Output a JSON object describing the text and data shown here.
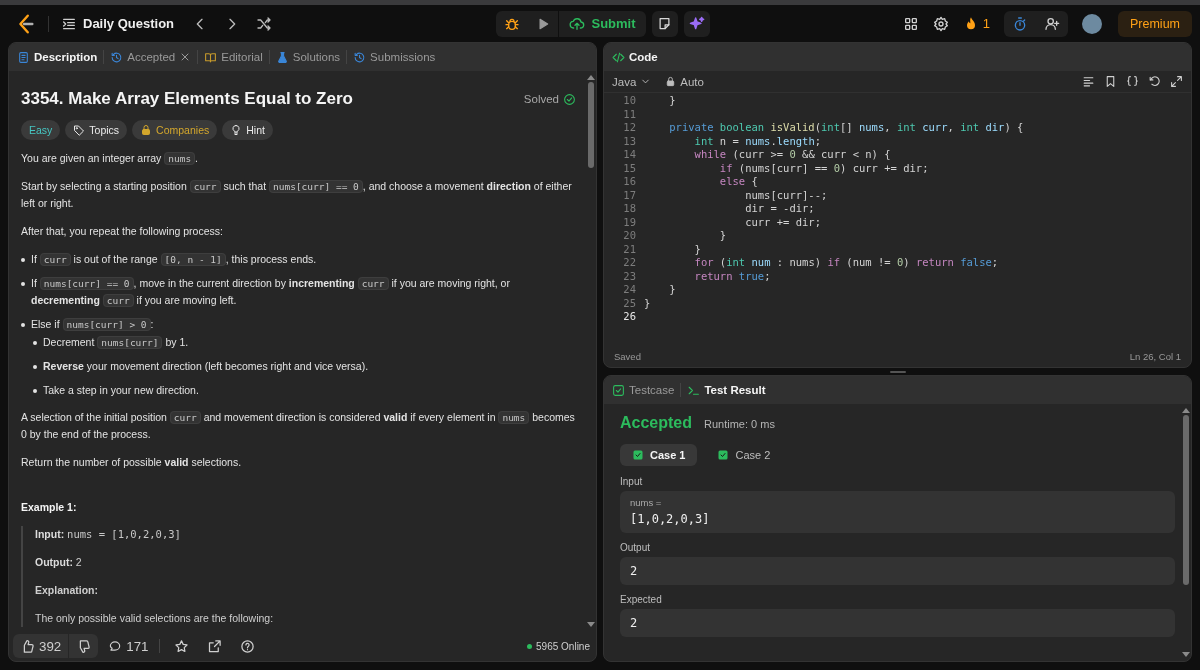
{
  "top_bar": {
    "title": "Daily Question",
    "submit": "Submit",
    "streak": "1",
    "premium": "Premium"
  },
  "description_panel": {
    "tabs": [
      {
        "label": "Description",
        "kind": "description",
        "selected": true,
        "closable": false
      },
      {
        "label": "Accepted",
        "kind": "accepted",
        "selected": false,
        "closable": true
      },
      {
        "label": "Editorial",
        "kind": "editorial",
        "selected": false,
        "closable": false
      },
      {
        "label": "Solutions",
        "kind": "solutions",
        "selected": false,
        "closable": false
      },
      {
        "label": "Submissions",
        "kind": "submissions",
        "selected": false,
        "closable": false
      }
    ],
    "title": "3354. Make Array Elements Equal to Zero",
    "status": "Solved",
    "tags": [
      {
        "label": "Easy",
        "kind": "difficulty"
      },
      {
        "label": "Topics",
        "kind": "topics"
      },
      {
        "label": "Companies",
        "kind": "companies"
      },
      {
        "label": "Hint",
        "kind": "hint"
      }
    ],
    "body": [
      {
        "kind": "paragraph",
        "segments": [
          {
            "kind": "text",
            "text": "You are given an integer array "
          },
          {
            "kind": "code",
            "text": "nums"
          },
          {
            "kind": "text",
            "text": "."
          }
        ]
      },
      {
        "kind": "paragraph",
        "segments": [
          {
            "kind": "text",
            "text": "Start by selecting a starting position "
          },
          {
            "kind": "code",
            "text": "curr"
          },
          {
            "kind": "text",
            "text": " such that "
          },
          {
            "kind": "code",
            "text": "nums[curr] == 0"
          },
          {
            "kind": "text",
            "text": ", and choose a movement **direction** of either left or right."
          }
        ]
      },
      {
        "kind": "paragraph",
        "segments": [
          {
            "kind": "text",
            "text": "After that, you repeat the following process:"
          }
        ]
      },
      {
        "kind": "list",
        "items": [
          {
            "segments": [
              {
                "kind": "text",
                "text": "If "
              },
              {
                "kind": "code",
                "text": "curr"
              },
              {
                "kind": "text",
                "text": " is out of the range "
              },
              {
                "kind": "code",
                "text": "[0, n - 1]"
              },
              {
                "kind": "text",
                "text": ", this process ends."
              }
            ]
          },
          {
            "segments": [
              {
                "kind": "text",
                "text": "If "
              },
              {
                "kind": "code",
                "text": "nums[curr] == 0"
              },
              {
                "kind": "text",
                "text": ", move in the current direction by **incrementing** "
              },
              {
                "kind": "code",
                "text": "curr"
              },
              {
                "kind": "text",
                "text": " if you are moving right, or **decrementing** "
              },
              {
                "kind": "code",
                "text": "curr"
              },
              {
                "kind": "text",
                "text": " if you are moving left."
              }
            ]
          },
          {
            "segments": [
              {
                "kind": "text",
                "text": "Else if "
              },
              {
                "kind": "code",
                "text": "nums[curr] > 0"
              },
              {
                "kind": "text",
                "text": ":"
              }
            ],
            "children": [
              {
                "segments": [
                  {
                    "kind": "text",
                    "text": "Decrement "
                  },
                  {
                    "kind": "code",
                    "text": "nums[curr]"
                  },
                  {
                    "kind": "text",
                    "text": " by 1."
                  }
                ]
              },
              {
                "segments": [
                  {
                    "kind": "text",
                    "text": "**Reverse** your movement direction (left becomes right and vice versa)."
                  }
                ]
              },
              {
                "segments": [
                  {
                    "kind": "text",
                    "text": "Take a step in your new direction."
                  }
                ]
              }
            ]
          }
        ]
      },
      {
        "kind": "paragraph",
        "segments": [
          {
            "kind": "text",
            "text": "A selection of the initial position "
          },
          {
            "kind": "code",
            "text": "curr"
          },
          {
            "kind": "text",
            "text": " and movement direction is considered **valid** if every element in "
          },
          {
            "kind": "code",
            "text": "nums"
          },
          {
            "kind": "text",
            "text": " becomes 0 by the end of the process."
          }
        ]
      },
      {
        "kind": "paragraph",
        "segments": [
          {
            "kind": "text",
            "text": "Return the number of possible **valid** selections."
          }
        ]
      },
      {
        "kind": "heading",
        "text": "Example 1:"
      },
      {
        "kind": "example",
        "lines": [
          {
            "segments": [
              {
                "kind": "text",
                "text": "**Input:** "
              },
              {
                "kind": "mono",
                "text": "nums = [1,0,2,0,3]"
              }
            ]
          },
          {
            "segments": [
              {
                "kind": "text",
                "text": "**Output:** 2"
              }
            ]
          },
          {
            "segments": [
              {
                "kind": "label",
                "text": "Explanation:"
              }
            ]
          },
          {
            "segments": [
              {
                "kind": "text",
                "text": "The only possible valid selections are the following:"
              }
            ]
          }
        ]
      }
    ],
    "footer": {
      "likes": "392",
      "comments": "171",
      "online": "5965 Online"
    }
  },
  "code_panel": {
    "title": "Code",
    "language": "Java",
    "mode": "Auto",
    "lines": [
      {
        "number": "10",
        "current": false,
        "tokens": [
          {
            "kind": "plain",
            "text": "    }"
          }
        ]
      },
      {
        "number": "11",
        "current": false
      },
      {
        "number": "12",
        "current": false,
        "tokens": [
          {
            "kind": "modifier",
            "text": "    private "
          },
          {
            "kind": "type",
            "text": "boolean "
          },
          {
            "kind": "function",
            "text": "isValid"
          },
          {
            "kind": "plain",
            "text": "("
          },
          {
            "kind": "type",
            "text": "int"
          },
          {
            "kind": "plain",
            "text": "[] "
          },
          {
            "kind": "variable",
            "text": "nums"
          },
          {
            "kind": "plain",
            "text": ", "
          },
          {
            "kind": "type",
            "text": "int "
          },
          {
            "kind": "variable",
            "text": "curr"
          },
          {
            "kind": "plain",
            "text": ", "
          },
          {
            "kind": "type",
            "text": "int "
          },
          {
            "kind": "variable",
            "text": "dir"
          },
          {
            "kind": "plain",
            "text": ") {"
          }
        ]
      },
      {
        "number": "13",
        "current": false,
        "tokens": [
          {
            "kind": "type",
            "text": "        int"
          },
          {
            "kind": "plain",
            "text": " n = "
          },
          {
            "kind": "variable",
            "text": "nums"
          },
          {
            "kind": "plain",
            "text": "."
          },
          {
            "kind": "variable",
            "text": "length"
          },
          {
            "kind": "plain",
            "text": ";"
          }
        ]
      },
      {
        "number": "14",
        "current": false,
        "tokens": [
          {
            "kind": "keyword",
            "text": "        while"
          },
          {
            "kind": "plain",
            "text": " (curr >= "
          },
          {
            "kind": "number",
            "text": "0"
          },
          {
            "kind": "plain",
            "text": " && curr < n) {"
          }
        ]
      },
      {
        "number": "15",
        "current": false,
        "tokens": [
          {
            "kind": "keyword",
            "text": "            if"
          },
          {
            "kind": "plain",
            "text": " (nums[curr] == "
          },
          {
            "kind": "number",
            "text": "0"
          },
          {
            "kind": "plain",
            "text": ") curr += dir;"
          }
        ]
      },
      {
        "number": "16",
        "current": false,
        "tokens": [
          {
            "kind": "keyword",
            "text": "            else"
          },
          {
            "kind": "plain",
            "text": " {"
          }
        ]
      },
      {
        "number": "17",
        "current": false,
        "tokens": [
          {
            "kind": "plain",
            "text": "                nums[curr]--;"
          }
        ]
      },
      {
        "number": "18",
        "current": false,
        "tokens": [
          {
            "kind": "plain",
            "text": "                dir = -dir;"
          }
        ]
      },
      {
        "number": "19",
        "current": false,
        "tokens": [
          {
            "kind": "plain",
            "text": "                curr += dir;"
          }
        ]
      },
      {
        "number": "20",
        "current": false,
        "tokens": [
          {
            "kind": "plain",
            "text": "            }"
          }
        ]
      },
      {
        "number": "21",
        "current": false,
        "tokens": [
          {
            "kind": "plain",
            "text": "        }"
          }
        ]
      },
      {
        "number": "22",
        "current": false,
        "tokens": [
          {
            "kind": "keyword",
            "text": "        for"
          },
          {
            "kind": "plain",
            "text": " ("
          },
          {
            "kind": "type",
            "text": "int "
          },
          {
            "kind": "variable",
            "text": "num"
          },
          {
            "kind": "plain",
            "text": " : nums) "
          },
          {
            "kind": "keyword",
            "text": "if"
          },
          {
            "kind": "plain",
            "text": " (num != "
          },
          {
            "kind": "number",
            "text": "0"
          },
          {
            "kind": "plain",
            "text": ") "
          },
          {
            "kind": "keyword",
            "text": "return "
          },
          {
            "kind": "modifier",
            "text": "false"
          },
          {
            "kind": "plain",
            "text": ";"
          }
        ]
      },
      {
        "number": "23",
        "current": false,
        "tokens": [
          {
            "kind": "keyword",
            "text": "        return "
          },
          {
            "kind": "modifier",
            "text": "true"
          },
          {
            "kind": "plain",
            "text": ";"
          }
        ]
      },
      {
        "number": "24",
        "current": false,
        "tokens": [
          {
            "kind": "plain",
            "text": "    }"
          }
        ]
      },
      {
        "number": "25",
        "current": false,
        "tokens": [
          {
            "kind": "plain",
            "text": "}"
          }
        ]
      },
      {
        "number": "26",
        "current": true
      }
    ],
    "status": "Saved",
    "cursor": "Ln 26, Col 1"
  },
  "test_panel": {
    "tabs": [
      {
        "label": "Testcase",
        "kind": "testcase",
        "selected": false
      },
      {
        "label": "Test Result",
        "kind": "result",
        "selected": true
      }
    ],
    "verdict": "Accepted",
    "runtime": "Runtime: 0 ms",
    "cases": [
      {
        "label": "Case 1",
        "selected": true,
        "passed": true
      },
      {
        "label": "Case 2",
        "selected": false,
        "passed": true
      }
    ],
    "input": {
      "label": "Input",
      "fields": [
        {
          "name": "nums =",
          "value": "[1,0,2,0,3]"
        }
      ]
    },
    "output": {
      "label": "Output",
      "value": "2"
    },
    "expected": {
      "label": "Expected",
      "value": "2"
    }
  }
}
